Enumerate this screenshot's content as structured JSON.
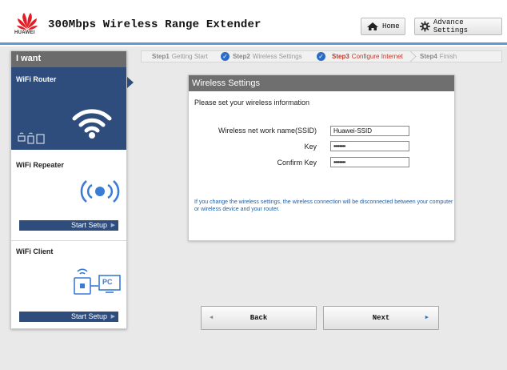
{
  "header": {
    "brand": "HUAWEI",
    "title": "300Mbps Wireless Range Extender",
    "home_label": "Home",
    "advance_label": "Advance Settings"
  },
  "sidebar": {
    "heading": "I want",
    "items": [
      {
        "label": "WiFi Router",
        "selected": true
      },
      {
        "label": "WiFi Repeater",
        "button": "Start Setup"
      },
      {
        "label": "WiFi Client",
        "button": "Start Setup",
        "badge": "PC"
      }
    ]
  },
  "steps": [
    {
      "num": "Step1",
      "label": "Getting Start",
      "state": "done"
    },
    {
      "num": "Step2",
      "label": "Wireless Settings",
      "state": "done"
    },
    {
      "num": "Step3",
      "label": "Configure Internet",
      "state": "current"
    },
    {
      "num": "Step4",
      "label": "Finish",
      "state": "pending"
    }
  ],
  "form": {
    "title": "Wireless Settings",
    "subtitle": "Please set your wireless information",
    "fields": [
      {
        "label": "Wireless net work name(SSID)",
        "value": "Huawei-SSID"
      },
      {
        "label": "Key",
        "value": "••••••••"
      },
      {
        "label": "Confirm Key",
        "value": "••••••••"
      }
    ],
    "warning": "If you change the wireless settings, the wireless connection will be disconnected between your computer or wireless device and your router."
  },
  "nav": {
    "back_label": "Back",
    "next_label": "Next"
  },
  "colors": {
    "accent": "#2f4d7c",
    "header_line": "#5b9bd5",
    "current_step": "#c0392b",
    "link_blue": "#1f5fa8"
  }
}
